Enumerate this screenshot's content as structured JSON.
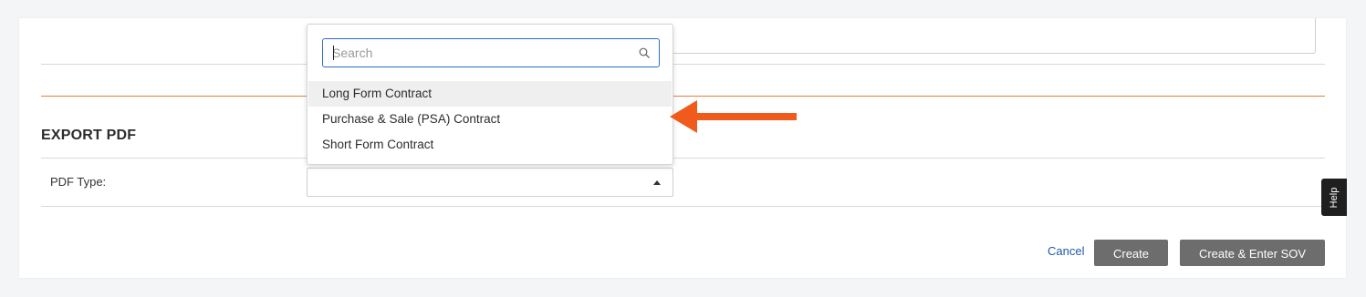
{
  "form": {
    "section_title": "EXPORT PDF",
    "pdf_type_label": "PDF Type:",
    "pdf_type_value": ""
  },
  "dropdown": {
    "search_placeholder": "Search",
    "search_value": "",
    "options": [
      {
        "label": "Long Form Contract",
        "hovered": true
      },
      {
        "label": "Purchase & Sale (PSA) Contract",
        "hovered": false
      },
      {
        "label": "Short Form Contract",
        "hovered": false
      }
    ]
  },
  "annotation": {
    "arrow_color": "#f05a1a",
    "arrow_points_to": "Purchase & Sale (PSA) Contract"
  },
  "actions": {
    "cancel_label": "Cancel",
    "create_label": "Create",
    "create_sov_label": "Create & Enter SOV"
  },
  "help": {
    "label": "Help"
  },
  "colors": {
    "accent_divider": "#e87d3a",
    "link": "#2358a6",
    "button_bg": "#6d6d6d",
    "focus_border": "#2d6dc6"
  }
}
